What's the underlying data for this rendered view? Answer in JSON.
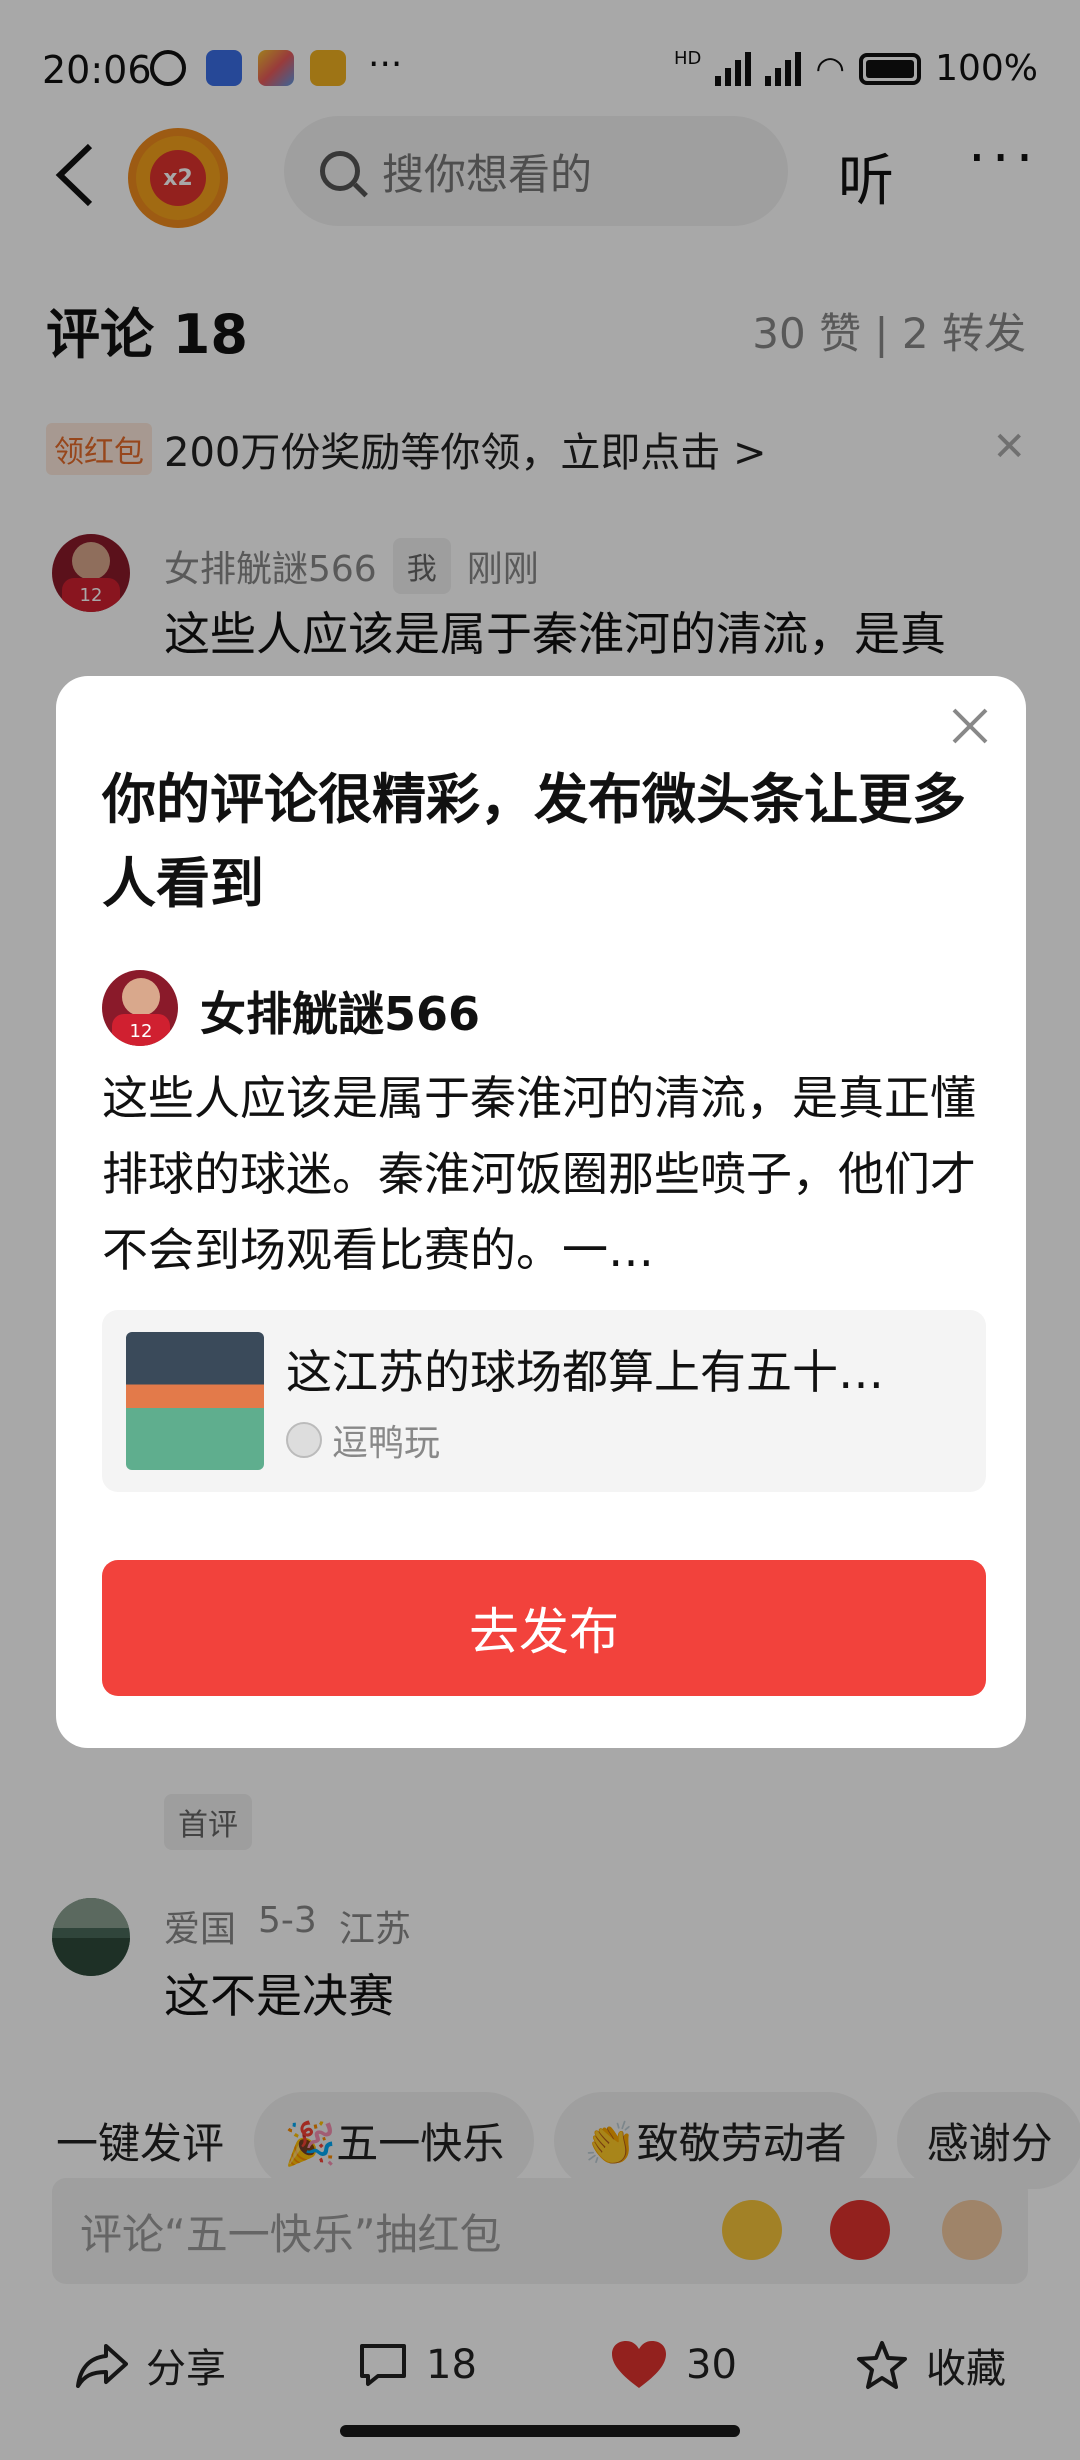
{
  "status_bar": {
    "time": "20:06",
    "battery": "100%",
    "hd_label": "HD"
  },
  "header": {
    "search_placeholder": "搜你想看的",
    "listen_label": "听",
    "more_label": "···"
  },
  "comments_header": {
    "title": "评论 18",
    "stats": "30 赞 | 2 转发"
  },
  "promo": {
    "tag": "领红包",
    "text": "200万份奖励等你领，立即点击 >"
  },
  "comments": [
    {
      "name": "女排觥謎566",
      "badge": "我",
      "time": "刚刚",
      "text": "这些人应该是属于秦淮河的清流，是真"
    },
    {
      "first_tag": "首评"
    },
    {
      "name": "爱国",
      "date": "5-3",
      "location": "江苏",
      "text": "这不是决赛"
    }
  ],
  "quick_replies": {
    "label": "一键发评",
    "chips": [
      "🎉五一快乐",
      "👏致敬劳动者",
      "感谢分"
    ]
  },
  "input": {
    "placeholder": "评论“五一快乐”抽红包"
  },
  "bottom_bar": {
    "share": "分享",
    "comments": "18",
    "likes": "30",
    "favorite": "收藏"
  },
  "dialog": {
    "title": "你的评论很精彩，发布微头条让更多人看到",
    "user_name": "女排觥謎566",
    "comment": "这些人应该是属于秦淮河的清流，是真正懂排球的球迷。秦淮河饭圈那些喷子，他们才不会到场观看比赛的。一…",
    "card_title": "这江苏的球场都算上有五十…",
    "card_source": "逗鸭玩",
    "publish_button": "去发布"
  },
  "colors": {
    "accent": "#f2423c",
    "like": "#e0322e"
  }
}
